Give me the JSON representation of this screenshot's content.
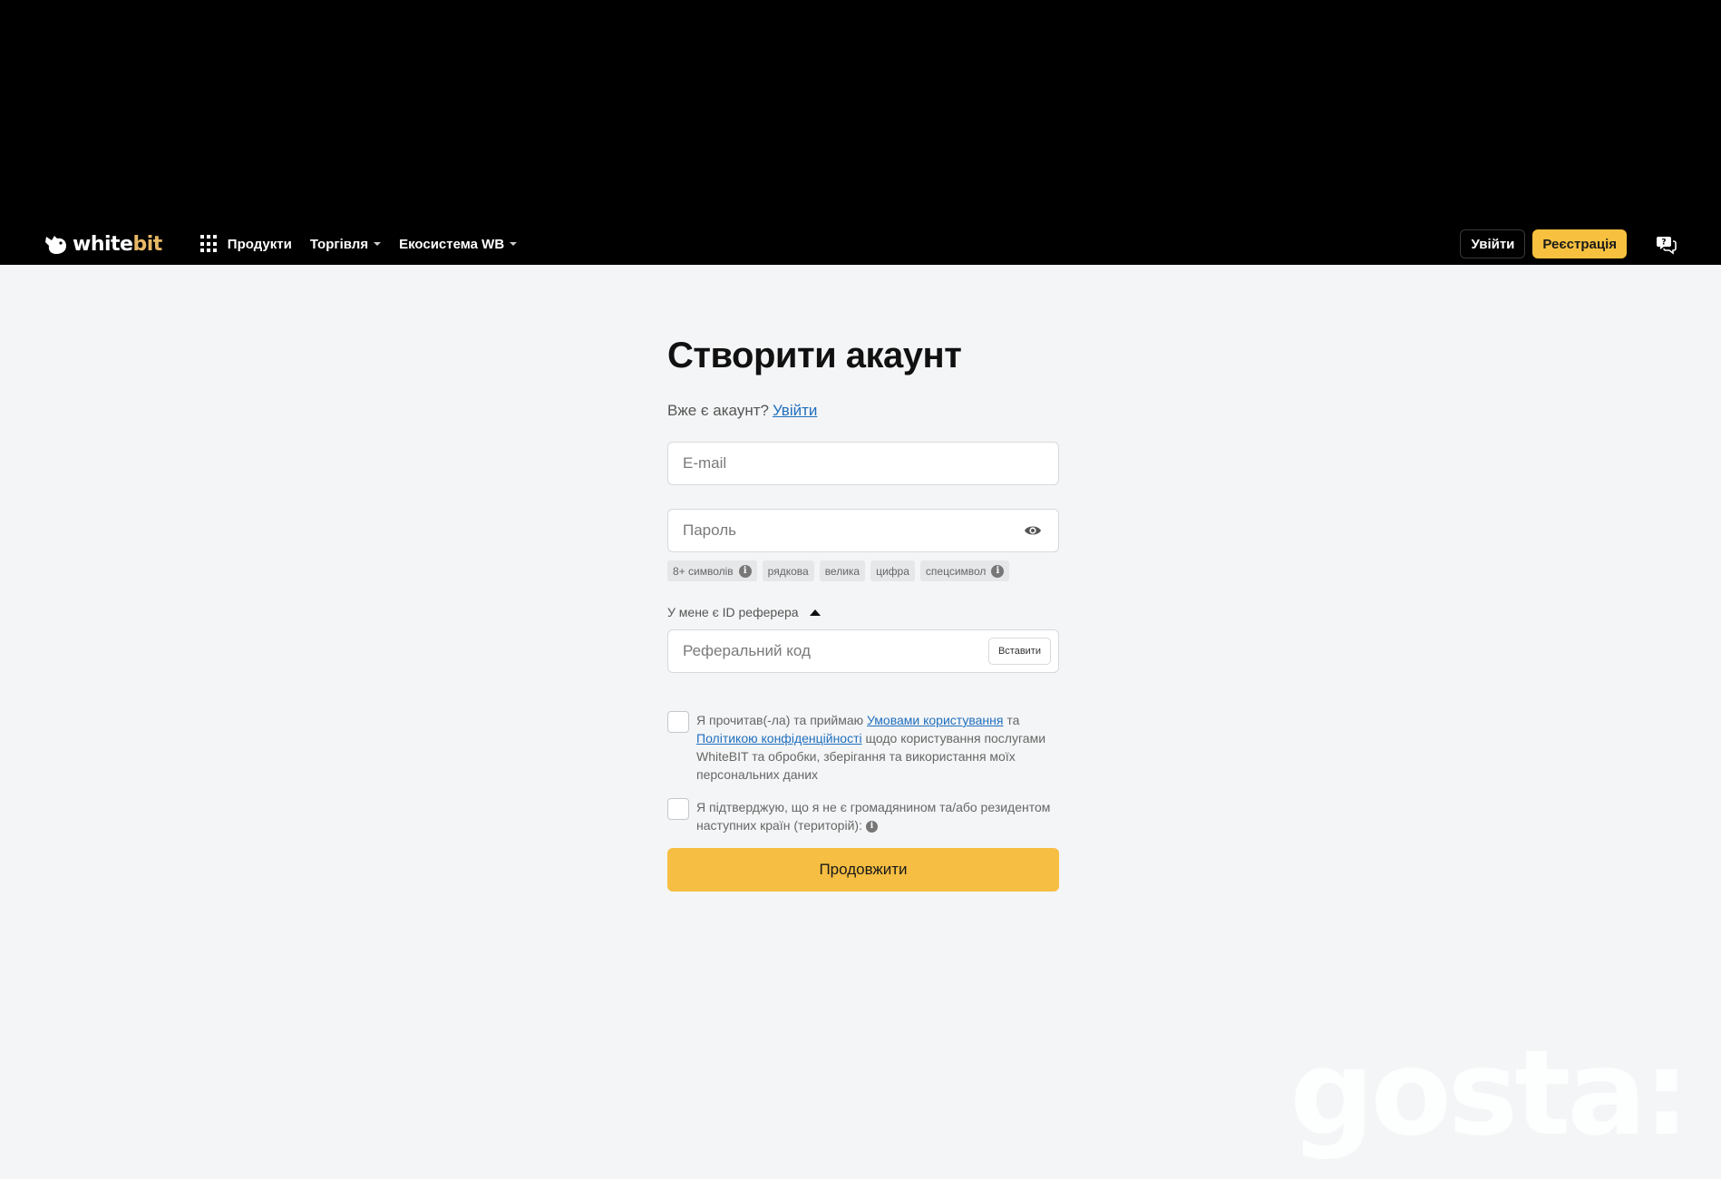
{
  "header": {
    "logo_text_main": "white",
    "logo_text_accent": "bit",
    "nav": [
      {
        "label": "Продукти"
      },
      {
        "label": "Торгівля"
      },
      {
        "label": "Екосистема WB"
      }
    ],
    "login_label": "Увійти",
    "register_label": "Реєстрація"
  },
  "form": {
    "title": "Створити акаунт",
    "have_account_text": "Вже є акаунт?",
    "have_account_link": "Увійти",
    "email_placeholder": "E-mail",
    "password_placeholder": "Пароль",
    "password_rules": [
      "8+ символів",
      "рядкова",
      "велика",
      "цифра",
      "спецсимвол"
    ],
    "referrer_toggle": "У мене є ID реферера",
    "referral_placeholder": "Реферальний код",
    "paste_label": "Вставити",
    "terms_prefix": "Я прочитав(-ла) та приймаю",
    "terms_link": "Умовами користування",
    "terms_and": "та",
    "privacy_link": "Політикою конфіденційності",
    "terms_suffix": "щодо користування послугами WhiteBIT та обробки, зберігання та використання моїх персональних даних",
    "residency_text": "Я підтверджую, що я не є громадянином та/або резидентом наступних країн (територій):",
    "submit_label": "Продовжити"
  },
  "watermark": "gosta:",
  "colors": {
    "accent": "#f6be42",
    "link": "#1f6fbf",
    "background": "#f4f5f6",
    "header": "#000000"
  }
}
